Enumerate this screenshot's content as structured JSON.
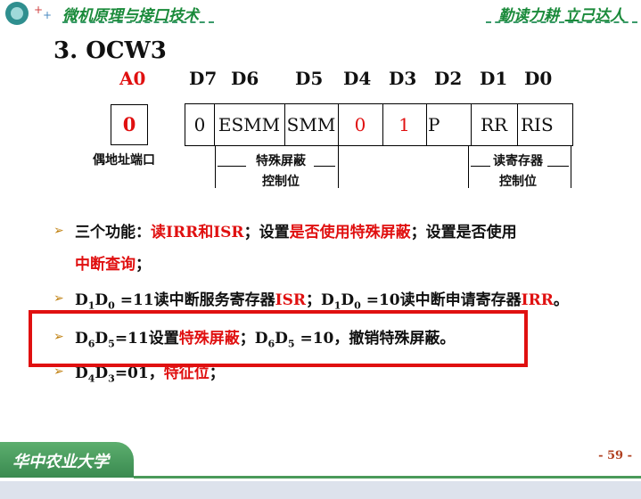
{
  "header": {
    "left_title": "微机原理与接口技术",
    "right_title": "勤读力耕  立己达人"
  },
  "heading": "3. OCW3",
  "register": {
    "a0_label": "A0",
    "bit_labels": [
      "D7",
      "D6",
      "D5",
      "D4",
      "D3",
      "D2",
      "D1",
      "D0"
    ],
    "a0_value": "0",
    "a0_caption": "偶地址端口",
    "cells": [
      "0",
      "ESMM",
      "SMM",
      "0",
      "1",
      "P",
      "RR",
      "RIS"
    ],
    "group1_label_l1": "特殊屏蔽",
    "group1_label_l2": "控制位",
    "group2_label_l1": "读寄存器",
    "group2_label_l2": "控制位"
  },
  "bullets": {
    "b1_a": "三个功能：",
    "b1_b": "读IRR和ISR",
    "b1_c": "；设置",
    "b1_d": "是否使用特殊屏蔽",
    "b1_e": "；设置是否使用",
    "b1_f": "中断查询",
    "b1_g": "；",
    "b2_d1": "D",
    "b2_s1": "1",
    "b2_d2": "D",
    "b2_s2": "0",
    "b2_rest1": " =11读中断服务寄存器",
    "b2_isr": "ISR",
    "b2_mid": "；D",
    "b2_s3": "1",
    "b2_d4": "D",
    "b2_s4": "0",
    "b2_rest2": " =10读中断申请寄存器",
    "b2_irr": "IRR",
    "b2_end": "。",
    "b3_d1": "D",
    "b3_s1": "6",
    "b3_d2": "D",
    "b3_s2": "5",
    "b3_rest1": "=11设置",
    "b3_red": "特殊屏蔽",
    "b3_mid": "；D",
    "b3_s3": "6",
    "b3_d4": "D",
    "b3_s4": "5",
    "b3_rest2": " =10，撤销特殊屏蔽。",
    "b4_d1": "D",
    "b4_s1": "4",
    "b4_d2": "D",
    "b4_s2": "3",
    "b4_rest": "=01，",
    "b4_red": "特征位",
    "b4_end": "；"
  },
  "footer": {
    "school": "华中农业大学",
    "page": "- 59 -"
  }
}
